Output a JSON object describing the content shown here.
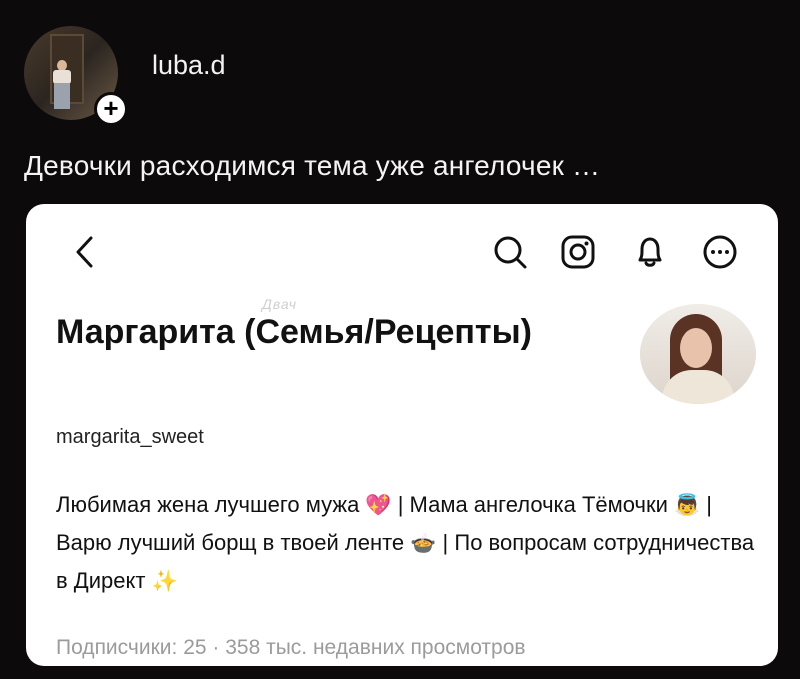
{
  "post": {
    "username": "luba.d",
    "caption": "Девочки расходимся тема уже ангелочек …",
    "follow_icon": "plus-icon"
  },
  "profile": {
    "name": "Маргарита (Семья/Рецепты)",
    "handle": "margarita_sweet",
    "bio_part1": "Любимая жена лучшего мужа ",
    "bio_emoji1": "💖",
    "bio_part2": " | Мама ангелочка Тёмочки ",
    "bio_emoji2": "👼",
    "bio_part3": " | Варю лучший борщ в твоей ленте ",
    "bio_emoji3": "🍲",
    "bio_part4": " | По вопросам сотрудничества в Директ ",
    "bio_emoji4": "✨",
    "stats": "Подписчики: 25 · 358 тыс. недавних просмотров",
    "watermark": "Двач"
  },
  "toolbar": {
    "icons": [
      "back-icon",
      "search-icon",
      "instagram-icon",
      "bell-icon",
      "more-icon"
    ]
  },
  "colors": {
    "page_bg": "#0c0a0b",
    "card_bg": "#ffffff",
    "muted_text": "#9b9b9b"
  }
}
